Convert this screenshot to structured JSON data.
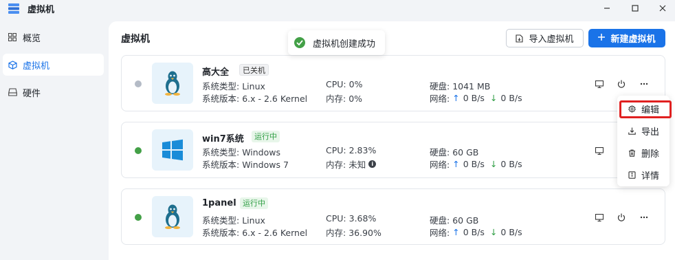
{
  "app": {
    "title": "虚拟机"
  },
  "sidebar": {
    "items": [
      {
        "label": "概览",
        "icon": "grid-icon"
      },
      {
        "label": "虚拟机",
        "icon": "cube-icon",
        "active": true
      },
      {
        "label": "硬件",
        "icon": "drive-icon"
      }
    ]
  },
  "main": {
    "title": "虚拟机",
    "import_label": "导入虚拟机",
    "new_label": "新建虚拟机"
  },
  "toast": {
    "text": "虚拟机创建成功"
  },
  "vms": [
    {
      "name": "高大全",
      "status": "已关机",
      "status_color": "#b4bbc6",
      "os_icon": "linux-penguin-icon",
      "type_label": "系统类型:",
      "type_value": "Linux",
      "version_label": "系统版本:",
      "version_value": "6.x - 2.6 Kernel",
      "cpu_label": "CPU:",
      "cpu_value": "0%",
      "mem_label": "内存:",
      "mem_value": "0%",
      "disk_label": "硬盘:",
      "disk_value": "1041 MB",
      "net_label": "网络:",
      "net_up": "0 B/s",
      "net_down": "0 B/s"
    },
    {
      "name": "win7系统",
      "status": "运行中",
      "status_color": "#43a047",
      "os_icon": "windows-icon",
      "type_label": "系统类型:",
      "type_value": "Windows",
      "version_label": "系统版本:",
      "version_value": "Windows 7",
      "cpu_label": "CPU:",
      "cpu_value": "2.83%",
      "mem_label": "内存:",
      "mem_value": "未知",
      "disk_label": "硬盘:",
      "disk_value": "60 GB",
      "net_label": "网络:",
      "net_up": "0 B/s",
      "net_down": "0 B/s"
    },
    {
      "name": "1panel",
      "status": "运行中",
      "status_color": "#43a047",
      "os_icon": "linux-penguin-icon",
      "type_label": "系统类型:",
      "type_value": "Linux",
      "version_label": "系统版本:",
      "version_value": "6.x - 2.6 Kernel",
      "cpu_label": "CPU:",
      "cpu_value": "3.68%",
      "mem_label": "内存:",
      "mem_value": "36.90%",
      "disk_label": "硬盘:",
      "disk_value": "60 GB",
      "net_label": "网络:",
      "net_up": "0 B/s",
      "net_down": "0 B/s"
    }
  ],
  "context_menu": {
    "items": [
      {
        "label": "编辑",
        "icon": "gear-icon"
      },
      {
        "label": "导出",
        "icon": "download-icon"
      },
      {
        "label": "删除",
        "icon": "trash-icon"
      },
      {
        "label": "详情",
        "icon": "info-doc-icon"
      }
    ]
  },
  "colors": {
    "accent": "#1a73e8",
    "running": "#43a047",
    "stopped": "#b4bbc6",
    "highlight": "#e02020"
  }
}
